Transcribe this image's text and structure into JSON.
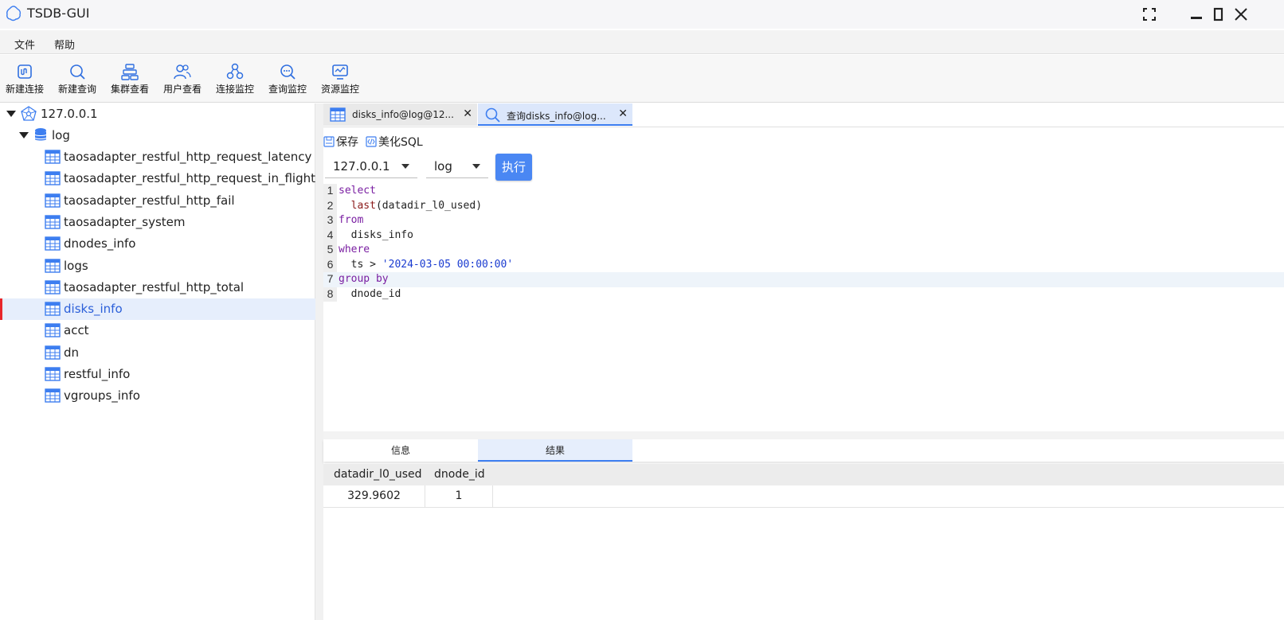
{
  "window": {
    "title": "TSDB-GUI"
  },
  "menu": [
    "文件",
    "帮助"
  ],
  "toolbar": [
    {
      "label": "新建连接",
      "icon": "new-connection-icon"
    },
    {
      "label": "新建查询",
      "icon": "search-icon"
    },
    {
      "label": "集群查看",
      "icon": "cluster-icon"
    },
    {
      "label": "用户查看",
      "icon": "users-icon"
    },
    {
      "label": "连接监控",
      "icon": "connection-monitor-icon"
    },
    {
      "label": "查询监控",
      "icon": "query-monitor-icon"
    },
    {
      "label": "资源监控",
      "icon": "resource-monitor-icon"
    }
  ],
  "tree": {
    "server": "127.0.0.1",
    "database": "log",
    "tables": [
      "taosadapter_restful_http_request_latency",
      "taosadapter_restful_http_request_in_flight",
      "taosadapter_restful_http_fail",
      "taosadapter_system",
      "dnodes_info",
      "logs",
      "taosadapter_restful_http_total",
      "disks_info",
      "acct",
      "dn",
      "restful_info",
      "vgroups_info"
    ],
    "selected": "disks_info"
  },
  "tabs": [
    {
      "label": "disks_info@log@12...",
      "icon": "table-icon",
      "active": false
    },
    {
      "label": "查询disks_info@log...",
      "icon": "search-icon",
      "active": true
    }
  ],
  "query_toolbar": {
    "save": "保存",
    "beautify": "美化SQL"
  },
  "selectors": {
    "server": "127.0.0.1",
    "database": "log"
  },
  "run_button": "执行",
  "editor": {
    "lines": [
      "1",
      "2",
      "3",
      "4",
      "5",
      "6",
      "7",
      "8"
    ],
    "active_line": 7,
    "code": {
      "l1": "select",
      "l2_fn": "last",
      "l2_arg": "(datadir_l0_used)",
      "l3": "from",
      "l4": "disks_info",
      "l5": "where",
      "l6_a": "ts > ",
      "l6_str": "'2024-03-05 00:00:00'",
      "l7": "group by",
      "l8": "dnode_id"
    }
  },
  "result_tabs": [
    {
      "label": "信息",
      "active": false
    },
    {
      "label": "结果",
      "active": true
    }
  ],
  "result": {
    "columns": [
      "datadir_l0_used",
      "dnode_id"
    ],
    "rows": [
      [
        "329.9602",
        "1"
      ]
    ]
  },
  "colors": {
    "accent": "#4a87f3",
    "selected_row": "#e6eefc",
    "selection_marker": "#e8262b"
  }
}
